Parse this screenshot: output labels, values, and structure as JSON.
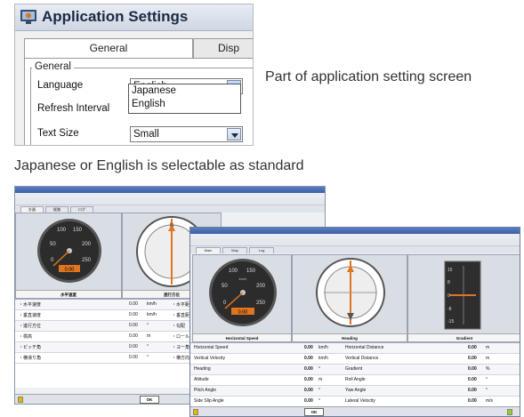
{
  "dialog": {
    "title": "Application Settings",
    "tabs": [
      "General",
      "Disp"
    ],
    "group_label": "General",
    "fields": [
      {
        "label": "Language",
        "value": "English"
      },
      {
        "label": "Refresh Interval",
        "value": ""
      },
      {
        "label": "Text Size",
        "value": "Small"
      }
    ],
    "dropdown_options": [
      "Japanese",
      "English"
    ]
  },
  "captions": {
    "dialog_caption": "Part of application setting screen",
    "language_caption": "Japanese or English is selectable as standard"
  },
  "jp_window": {
    "tabs": [
      "計器",
      "経路",
      "ログ"
    ],
    "speed_caption": "水平速度",
    "heading_caption": "進行方位",
    "speed_readout": "0.00",
    "rows": [
      {
        "label": "・水平速度",
        "value": "0.00",
        "unit": "km/h",
        "label2": "・水平距"
      },
      {
        "label": "・垂直速度",
        "value": "0.00",
        "unit": "km/h",
        "label2": "・垂直距"
      },
      {
        "label": "・進行方位",
        "value": "0.00",
        "unit": "°",
        "label2": "・勾配"
      },
      {
        "label": "・標高",
        "value": "0.00",
        "unit": "m",
        "label2": "・ロール角"
      },
      {
        "label": "・ピッチ角",
        "value": "0.00",
        "unit": "°",
        "label2": "・ヨー角"
      },
      {
        "label": "・横滑り角",
        "value": "0.00",
        "unit": "°",
        "label2": "・横方向"
      }
    ],
    "ok_label": "OK"
  },
  "en_window": {
    "tabs": [
      "Main",
      "Map",
      "Log"
    ],
    "speed_caption": "Horizontal Speed",
    "heading_caption": "Heading",
    "gradient_caption": "Gradient",
    "speed_readout": "0.00",
    "gauge_ticks": [
      "50",
      "100",
      "150",
      "200",
      "250",
      "0"
    ],
    "gauge_unit": "km/h",
    "gradient_ticks": [
      "15",
      "8",
      "0",
      "-8",
      "-15"
    ],
    "rows": [
      {
        "label": "Horizontal Speed",
        "value": "0.00",
        "unit": "km/h",
        "label2": "Horizontal Distance",
        "value2": "0.00",
        "unit2": "m"
      },
      {
        "label": "Vertical Velocity",
        "value": "0.00",
        "unit": "km/h",
        "label2": "Vertical Distance",
        "value2": "0.00",
        "unit2": "m"
      },
      {
        "label": "Heading",
        "value": "0.00",
        "unit": "°",
        "label2": "Gradient",
        "value2": "0.00",
        "unit2": "%"
      },
      {
        "label": "Altitude",
        "value": "0.00",
        "unit": "m",
        "label2": "Roll Angle",
        "value2": "0.00",
        "unit2": "°"
      },
      {
        "label": "Pitch Angle",
        "value": "0.00",
        "unit": "°",
        "label2": "Yaw Angle",
        "value2": "0.00",
        "unit2": "°"
      },
      {
        "label": "Side Slip Angle",
        "value": "0.00",
        "unit": "°",
        "label2": "Lateral Velocity",
        "value2": "0.00",
        "unit2": "m/s"
      }
    ],
    "ok_label": "OK"
  },
  "colors": {
    "accent": "#e0751f",
    "title_bar": "#3b5ea6"
  }
}
